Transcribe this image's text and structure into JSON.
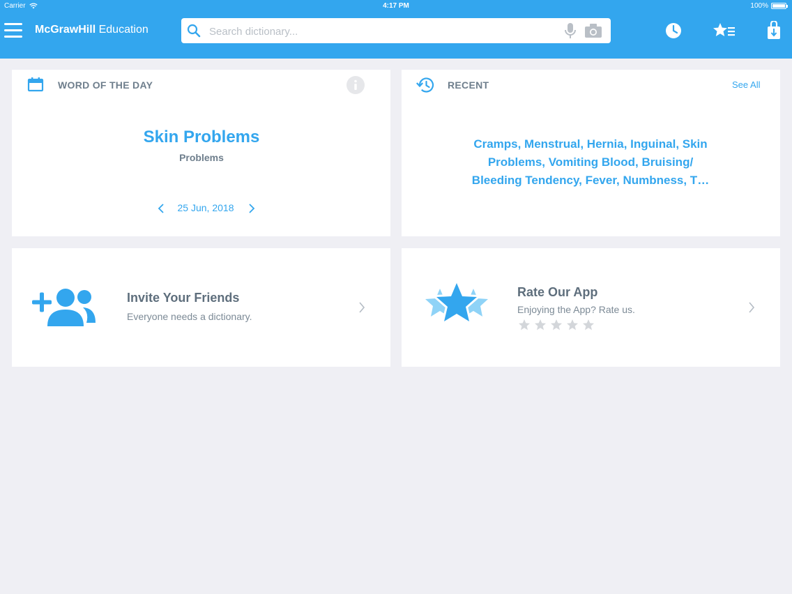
{
  "status_bar": {
    "carrier": "Carrier",
    "time": "4:17 PM",
    "battery": "100%"
  },
  "header": {
    "brand_bold": "McGrawHill",
    "brand_light": "Education",
    "search_placeholder": "Search dictionary..."
  },
  "word_of_the_day": {
    "heading": "WORD OF THE DAY",
    "word": "Skin Problems",
    "subtitle": "Problems",
    "date": "25 Jun, 2018"
  },
  "recent": {
    "heading": "RECENT",
    "see_all": "See All",
    "terms": "Cramps, Menstrual, Hernia, Inguinal, Skin Problems, Vomiting Blood, Bruising/ Bleeding Tendency, Fever, Numbness, T…"
  },
  "invite": {
    "title": "Invite Your Friends",
    "subtitle": "Everyone needs a dictionary."
  },
  "rate": {
    "title": "Rate Our App",
    "subtitle": "Enjoying the App? Rate us.",
    "rating": 0,
    "max_rating": 5
  },
  "colors": {
    "accent": "#33a6ee",
    "background": "#efeff4",
    "card": "#ffffff"
  },
  "icons": [
    "menu-icon",
    "search-icon",
    "microphone-icon",
    "camera-icon",
    "history-clock-icon",
    "favorites-list-icon",
    "download-icon",
    "calendar-icon",
    "info-icon",
    "recent-history-icon",
    "add-friends-icon",
    "rate-stars-icon"
  ]
}
